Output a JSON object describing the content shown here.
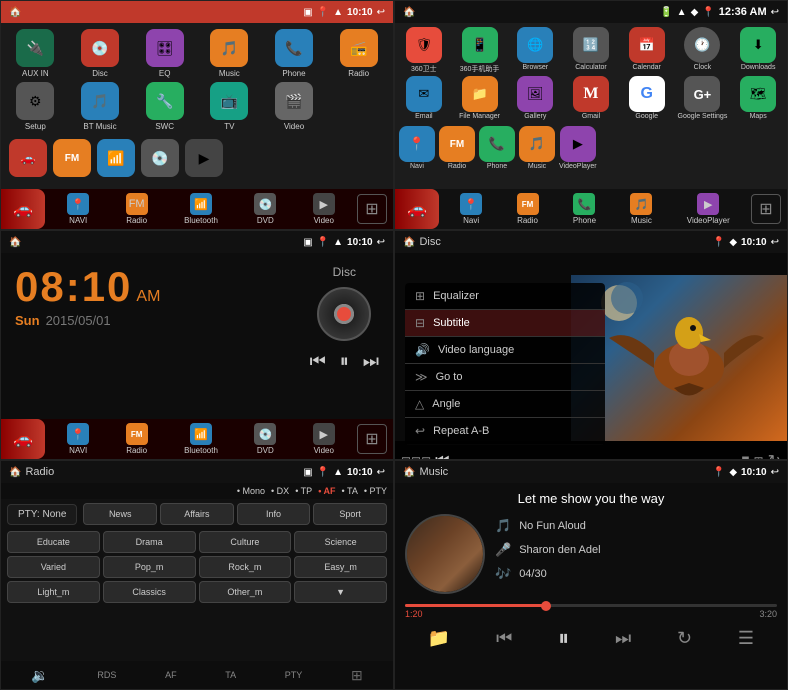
{
  "panel1": {
    "status": {
      "time": "10:10",
      "icons": [
        "sd",
        "pin",
        "wifi"
      ]
    },
    "apps": [
      {
        "label": "AUX IN",
        "color": "#1a6b4a",
        "icon": "🔌"
      },
      {
        "label": "Disc",
        "color": "#c0392b",
        "icon": "💿"
      },
      {
        "label": "EQ",
        "color": "#8e44ad",
        "icon": "🎛"
      },
      {
        "label": "Music",
        "color": "#e67e22",
        "icon": "🎵"
      },
      {
        "label": "Phone",
        "color": "#2980b9",
        "icon": "📞"
      },
      {
        "label": "Radio",
        "color": "#e67e22",
        "icon": "📻"
      },
      {
        "label": "Setup",
        "color": "#555",
        "icon": "⚙"
      },
      {
        "label": "BT Music",
        "color": "#2980b9",
        "icon": "🎵"
      },
      {
        "label": "SWC",
        "color": "#27ae60",
        "icon": "🔧"
      },
      {
        "label": "TV",
        "color": "#16a085",
        "icon": "📺"
      },
      {
        "label": "Video",
        "color": "#666",
        "icon": "🎬"
      }
    ],
    "nav": [
      {
        "label": "NAVI",
        "icon": "📍"
      },
      {
        "label": "Radio",
        "icon": "📻"
      },
      {
        "label": "Bluetooth",
        "icon": "📶"
      },
      {
        "label": "DVD",
        "icon": "💿"
      },
      {
        "label": "Video",
        "icon": "🎬"
      }
    ]
  },
  "panel2": {
    "status": {
      "time": "12:36 AM"
    },
    "apps": [
      {
        "label": "360卫士",
        "color": "#e74c3c",
        "icon": "🛡"
      },
      {
        "label": "360手机助手",
        "color": "#27ae60",
        "icon": "📱"
      },
      {
        "label": "Browser",
        "color": "#2980b9",
        "icon": "🌐"
      },
      {
        "label": "Calculator",
        "color": "#555",
        "icon": "🔢"
      },
      {
        "label": "Calendar",
        "color": "#c0392b",
        "icon": "📅"
      },
      {
        "label": "Clock",
        "color": "#555",
        "icon": "🕐"
      },
      {
        "label": "Downloads",
        "color": "#27ae60",
        "icon": "⬇"
      },
      {
        "label": "Email",
        "color": "#2980b9",
        "icon": "✉"
      },
      {
        "label": "File Manager",
        "color": "#e67e22",
        "icon": "📁"
      },
      {
        "label": "Gallery",
        "color": "#8e44ad",
        "icon": "🖼"
      },
      {
        "label": "Gmail",
        "color": "#c0392b",
        "icon": "M"
      },
      {
        "label": "Google",
        "color": "#2980b9",
        "icon": "G"
      },
      {
        "label": "Google Settings",
        "color": "#555",
        "icon": "G"
      },
      {
        "label": "Maps",
        "color": "#27ae60",
        "icon": "🗺"
      },
      {
        "label": "Navi",
        "color": "#2980b9",
        "icon": "📍"
      },
      {
        "label": "Radio",
        "color": "#e67e22",
        "icon": "📻"
      },
      {
        "label": "Phone",
        "color": "#27ae60",
        "icon": "📞"
      },
      {
        "label": "Music",
        "color": "#e67e22",
        "icon": "🎵"
      },
      {
        "label": "VideoPlayer",
        "color": "#8e44ad",
        "icon": "▶"
      }
    ],
    "nav": [
      {
        "label": "Navi"
      },
      {
        "label": "Radio"
      },
      {
        "label": "Phone"
      },
      {
        "label": "Music"
      },
      {
        "label": "VideoPlayer"
      }
    ]
  },
  "panel3": {
    "status": {
      "time": "10:10"
    },
    "clock": {
      "time": "08:10",
      "ampm": "AM",
      "day": "Sun",
      "date": "2015/05/01"
    },
    "media": {
      "label": "Disc"
    },
    "nav": [
      {
        "label": "NAVI"
      },
      {
        "label": "Radio"
      },
      {
        "label": "Bluetooth"
      },
      {
        "label": "DVD"
      },
      {
        "label": "Video"
      }
    ]
  },
  "panel4": {
    "status": {
      "title": "Disc",
      "time": "10:10"
    },
    "menu": [
      {
        "label": "Equalizer",
        "icon": "⊞"
      },
      {
        "label": "Subtitle",
        "icon": "⊟",
        "highlighted": true
      },
      {
        "label": "Video language",
        "icon": "🔊"
      },
      {
        "label": "Go to",
        "icon": "≫"
      },
      {
        "label": "Angle",
        "icon": "△"
      },
      {
        "label": "Repeat A-B",
        "icon": "↩"
      }
    ]
  },
  "panel5": {
    "status": {
      "title": "Radio",
      "time": "10:10"
    },
    "indicators": [
      "Mono",
      "DX",
      "TP",
      "AF",
      "TA",
      "PTY"
    ],
    "pty": {
      "label": "PTY:",
      "value": "None"
    },
    "buttons": [
      [
        "News",
        "Affairs",
        "Info",
        "Sport"
      ],
      [
        "Educate",
        "Drama",
        "Culture",
        "Science"
      ],
      [
        "Varied",
        "Pop_m",
        "Rock_m",
        "Easy_m"
      ],
      [
        "Light_m",
        "Classics",
        "Other_m",
        "▼"
      ]
    ],
    "bottomNav": [
      "RDS",
      "AF",
      "TA",
      "PTY"
    ]
  },
  "panel6": {
    "status": {
      "title": "Music",
      "time": "10:10"
    },
    "song": {
      "title": "Let me show you the way",
      "artist": "No Fun Aloud",
      "album": "Sharon den Adel",
      "track": "04/30",
      "currentTime": "1:20",
      "totalTime": "3:20",
      "progress": 38
    }
  }
}
